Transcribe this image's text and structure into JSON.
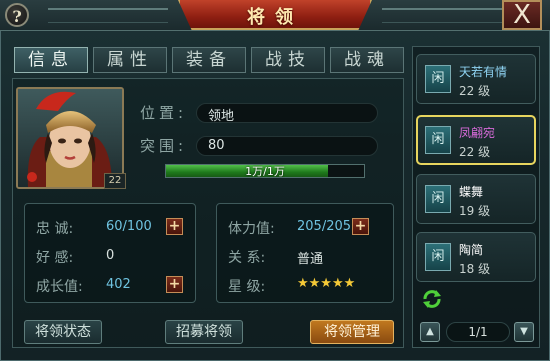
{
  "header": {
    "title": "将领",
    "help_label": "?",
    "close_label": "X"
  },
  "tabs": [
    {
      "label": "信息",
      "active": true
    },
    {
      "label": "属性",
      "active": false
    },
    {
      "label": "装备",
      "active": false
    },
    {
      "label": "战技",
      "active": false
    },
    {
      "label": "战魂",
      "active": false
    }
  ],
  "general": {
    "level_badge": "22",
    "position_label": "位置:",
    "position_value": "领地",
    "breakthrough_label": "突围:",
    "breakthrough_value": "80",
    "troops_text": "1万/1万",
    "troops_fraction": 1.0
  },
  "stats_left": [
    {
      "label": "忠 诚:",
      "value": "60/100",
      "has_plus": true
    },
    {
      "label": "好 感:",
      "value": "0",
      "has_plus": false
    },
    {
      "label": "成长值:",
      "value": "402",
      "has_plus": true
    }
  ],
  "stats_right": [
    {
      "label": "体力值:",
      "value": "205/205",
      "has_plus": true
    },
    {
      "label": "关 系:",
      "value": "普通",
      "has_plus": false
    },
    {
      "label": "星 级:",
      "value": "★★★★★",
      "stars": 5
    }
  ],
  "buttons": {
    "status": "将领状态",
    "recruit": "招募将领",
    "manage": "将领管理"
  },
  "generals_list": [
    {
      "status": "闲",
      "name": "天若有情",
      "level": "22 级",
      "selected": false,
      "name_color": "#8fd3f2"
    },
    {
      "status": "闲",
      "name": "凤翩宛",
      "level": "22 级",
      "selected": true,
      "name_color": "#d66ad8"
    },
    {
      "status": "闲",
      "name": "蝶舞",
      "level": "19 级",
      "selected": false,
      "name_color": "#ffffff"
    },
    {
      "status": "闲",
      "name": "陶简",
      "level": "18 级",
      "selected": false,
      "name_color": "#ffffff"
    }
  ],
  "pager": {
    "text": "1/1",
    "up_icon": "chevron-up-icon",
    "down_icon": "chevron-down-icon"
  },
  "colors": {
    "accent_gold": "#e7d55e",
    "title_red": "#a52c18",
    "hp_green": "#2e9e2a",
    "plus_red": "#7a2c1a"
  }
}
